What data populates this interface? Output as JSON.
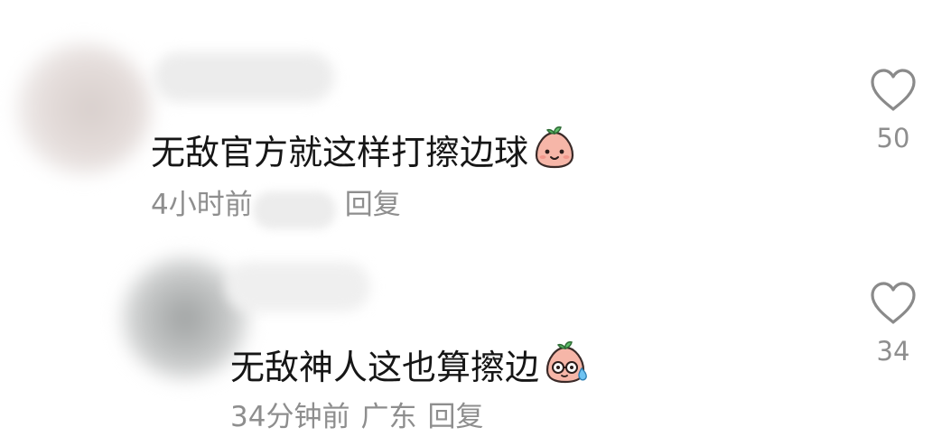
{
  "comments": [
    {
      "text": "无敌官方就这样打擦边球",
      "emoji": "peach-smile-emoji",
      "time": "4小时前",
      "location": "",
      "reply_label": "回复",
      "likes": "50",
      "author_blurred": true
    },
    {
      "text": "无敌神人这也算擦边",
      "emoji": "peach-sweat-glasses-emoji",
      "time": "34分钟前",
      "location": "广东",
      "reply_label": "回复",
      "likes": "34",
      "author_blurred": true
    }
  ],
  "icons": {
    "like": "heart-outline-icon"
  },
  "colors": {
    "text": "#161616",
    "meta": "#8e8e8e",
    "icon": "#8a8a8a"
  }
}
